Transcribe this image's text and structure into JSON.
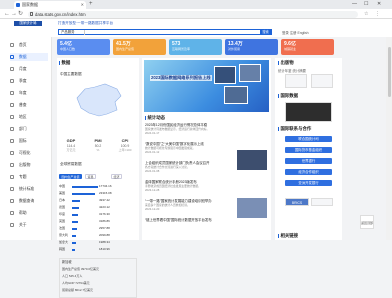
{
  "browser": {
    "tab_title": "国家数据",
    "new_tab": "+",
    "url": "data.stats.gov.cn/index.htm",
    "minimize": "—",
    "maximize": "☐",
    "close": "✕"
  },
  "header": {
    "logo_text": "国家统计局",
    "headline": "打造开放型·一带一路数据共享平台",
    "search_scope": "产品服务",
    "search_button": "搜索",
    "links": "登录 注册 English"
  },
  "nav": {
    "items": [
      {
        "label": "首页"
      },
      {
        "label": "数据"
      },
      {
        "label": "月度"
      },
      {
        "label": "季度"
      },
      {
        "label": "年度"
      },
      {
        "label": "普查"
      },
      {
        "label": "地区"
      },
      {
        "label": "部门"
      },
      {
        "label": "国际"
      },
      {
        "label": "可视化"
      },
      {
        "label": "出版物"
      },
      {
        "label": "专题"
      },
      {
        "label": "统计标准"
      },
      {
        "label": "数据查询"
      },
      {
        "label": "帮助"
      },
      {
        "label": "关于"
      }
    ]
  },
  "stat_cards": [
    {
      "num": "5.4亿",
      "label": "中国人口数",
      "color": "#5a8df0"
    },
    {
      "num": "41.5万",
      "label": "国内生产总值",
      "color": "#f2a23a"
    },
    {
      "num": "573",
      "label": "互联网普及率",
      "color": "#5fb3e8"
    },
    {
      "num": "13.4万",
      "label": "对外贸易",
      "color": "#3f74e0"
    },
    {
      "num": "9.6亿",
      "label": "城镇就业",
      "color": "#f06e4f"
    }
  ],
  "left_panel": {
    "title": "数据",
    "subhead": "中国主要数据",
    "kpis": [
      {
        "k": "GDP",
        "v": "114.4",
        "u": "万亿元"
      },
      {
        "k": "PMI",
        "v": "50.2",
        "u": "%"
      },
      {
        "k": "CPI",
        "v": "100.9",
        "u": "上年=100"
      }
    ],
    "trade_title": "全球贸易数据",
    "pills": [
      "国内生产总值",
      "贸易",
      "经济"
    ],
    "bars": [
      {
        "name": "中国",
        "value": "17734.16",
        "frac": 1.0
      },
      {
        "name": "美国",
        "value": "23315.08",
        "frac": 0.9
      },
      {
        "name": "日本",
        "value": "4937.42",
        "frac": 0.32
      },
      {
        "name": "德国",
        "value": "4223.12",
        "frac": 0.28
      },
      {
        "name": "印度",
        "value": "3176.30",
        "frac": 0.22
      },
      {
        "name": "英国",
        "value": "3186.86",
        "frac": 0.22
      },
      {
        "name": "法国",
        "value": "2957.88",
        "frac": 0.2
      },
      {
        "name": "意大利",
        "value": "2099.88",
        "frac": 0.15
      },
      {
        "name": "加拿大",
        "value": "1988.34",
        "frac": 0.14
      },
      {
        "name": "韩国",
        "value": "1810.96",
        "frac": 0.13
      }
    ],
    "minicard": {
      "title": "新加坡",
      "rows": [
        "国内生产总值  3970.0亿美元",
        "人口  545.4万人",
        "人均GDP  72794美元",
        "贸易总额  8012.7亿美元"
      ]
    }
  },
  "mid_panel": {
    "banner_title": "2023国际数据网络系列报告上线",
    "news_header": "统计动态",
    "news": [
      {
        "title": "2023年12月份国民经济运行情况总体平稳",
        "desc": "国家统计局发布数据显示，经济运行总体回升向好。",
        "date": "2024-01-17"
      },
      {
        "title": "“数说中国”之“大美中国”数字化展示上线",
        "desc": "统计数据可视化专题展示中国发展成就。",
        "date": "2024-01-12"
      },
      {
        "title": "上合组织成员国家统计部门负责人会议召开",
        "desc": "各方就统计合作交流进行深入讨论。",
        "date": "2024-01-08"
      },
      {
        "title": "金砖国家联合统计手册2023版发布",
        "desc": "手册收录成员国经济社会发展主要统计数据。",
        "date": "2023-12-28"
      },
      {
        "title": "“一带一路”国家统计发展能力建设培训班举办",
        "desc": "来自多个国家的统计人员参加培训。",
        "date": "2023-12-20"
      },
      {
        "title": "“链上世界看中国”国际统计数据开放平台发布",
        "desc": "",
        "date": ""
      }
    ]
  },
  "right_panel": {
    "pub_title": "出版物",
    "tabs": "统计年鉴 统计摘要",
    "docs_title": "国际数据",
    "links_title": "国际联系与合作",
    "buttons": [
      "联合国统计司",
      "国际货币基金组织",
      "世界银行",
      "经济合作组织",
      "亚洲开发银行"
    ],
    "brics": "BRICS",
    "links_title2": "相关链接"
  },
  "float_widget": "返回顶部"
}
